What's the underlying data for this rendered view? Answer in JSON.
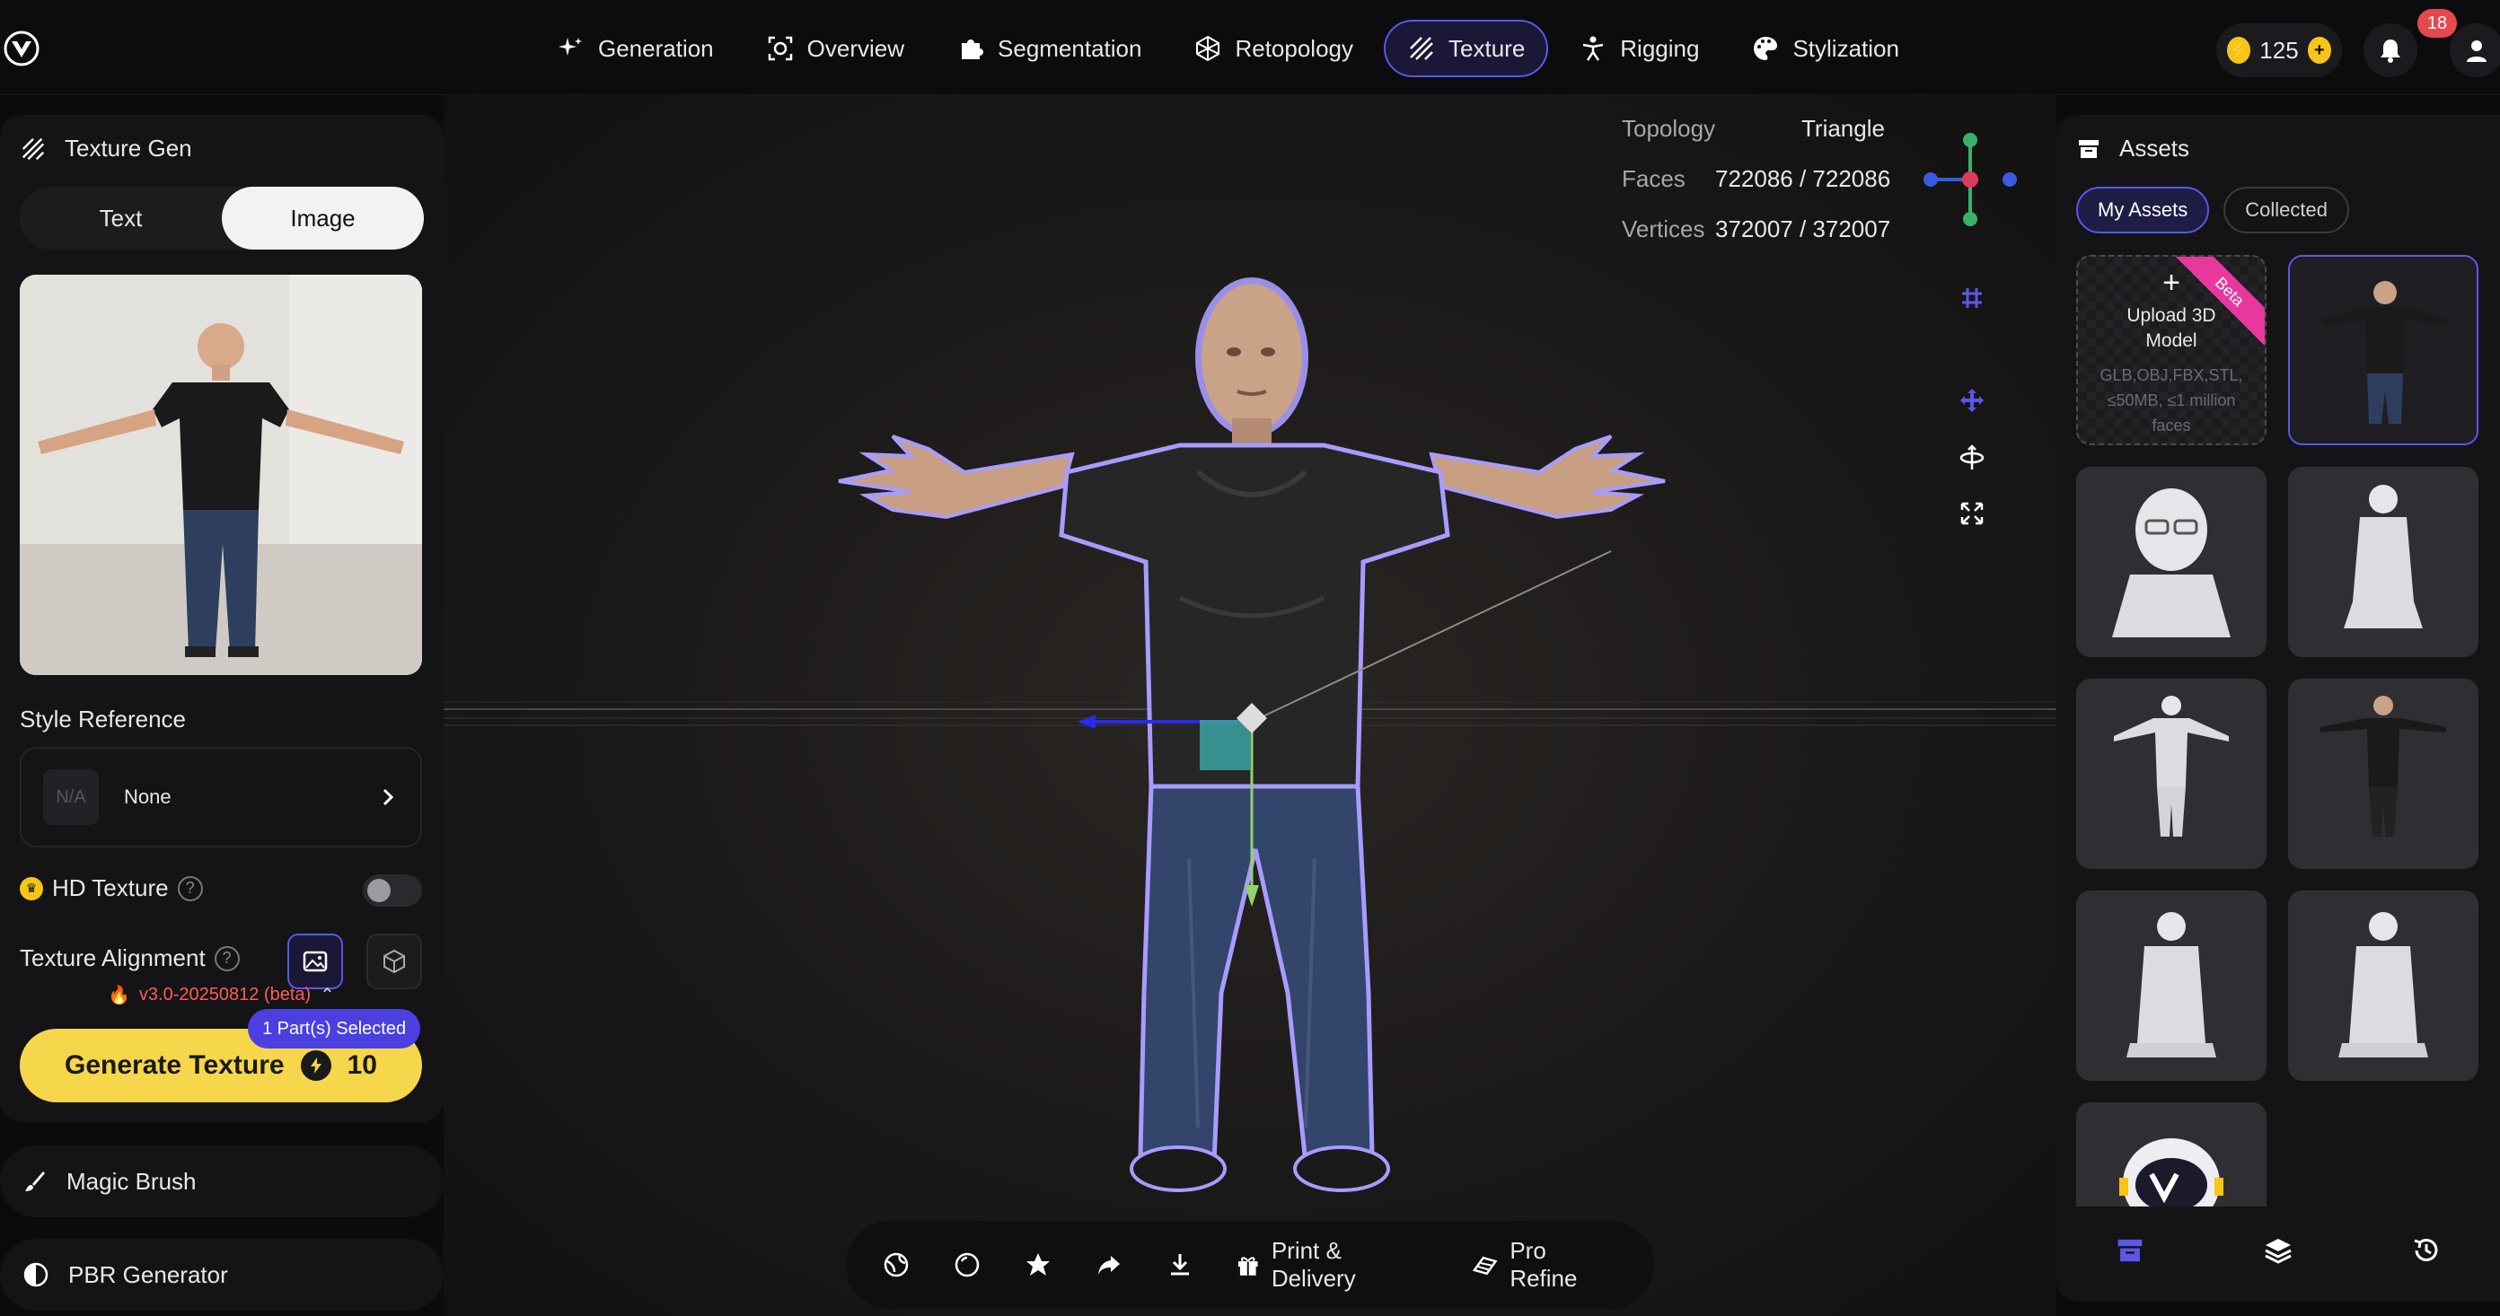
{
  "nav": {
    "items": [
      {
        "label": "Generation",
        "icon": "sparkle-icon"
      },
      {
        "label": "Overview",
        "icon": "overview-icon"
      },
      {
        "label": "Segmentation",
        "icon": "puzzle-icon"
      },
      {
        "label": "Retopology",
        "icon": "cube-wire-icon"
      },
      {
        "label": "Texture",
        "icon": "texture-icon",
        "active": true
      },
      {
        "label": "Rigging",
        "icon": "person-icon"
      },
      {
        "label": "Stylization",
        "icon": "palette-icon"
      }
    ],
    "credits": "125",
    "notifications": "18"
  },
  "left": {
    "title": "Texture Gen",
    "mode_tabs": [
      "Text",
      "Image"
    ],
    "active_mode": "Image",
    "style_reference_label": "Style Reference",
    "style_placeholder": "N/A",
    "style_value": "None",
    "hd_texture_label": "HD Texture",
    "alignment_label": "Texture Alignment",
    "version": "v3.0-20250812 (beta)",
    "parts_selected": "1 Part(s) Selected",
    "generate_label": "Generate Texture",
    "generate_cost": "10",
    "magic_brush": "Magic Brush",
    "pbr_generator": "PBR Generator"
  },
  "viewport": {
    "topology_label": "Topology",
    "topology_value": "Triangle",
    "faces_label": "Faces",
    "faces_value": "722086 / 722086",
    "vertices_label": "Vertices",
    "vertices_value": "372007 / 372007"
  },
  "bottom_bar": {
    "print_label": "Print & Delivery",
    "refine_label": "Pro Refine"
  },
  "assets": {
    "title": "Assets",
    "tabs": [
      "My Assets",
      "Collected"
    ],
    "upload_title": "Upload 3D Model",
    "upload_formats": "GLB,OBJ,FBX,STL, ≤50MB, ≤1 million faces",
    "beta": "Beta"
  },
  "colors": {
    "accent": "#5b57e8",
    "button": "#f6d64a",
    "badge": "#e5484d",
    "beta": "#e8389e"
  }
}
